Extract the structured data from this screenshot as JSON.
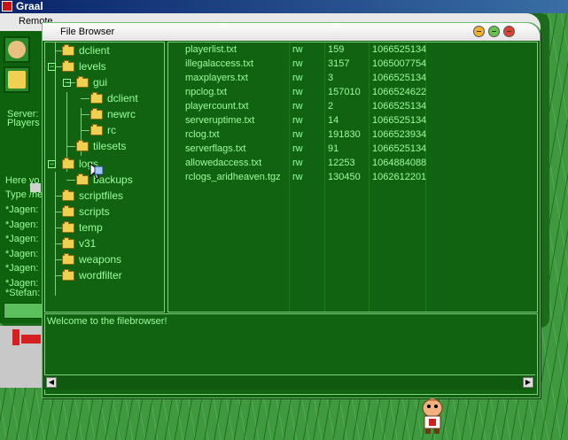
{
  "os": {
    "title": "Graal"
  },
  "remote": {
    "tab_label": "Remote",
    "side_labels": [
      "Server:",
      "Players"
    ],
    "chat_lines": [
      "Here yo",
      "Type /he",
      "*Jagen:",
      "*Jagen:",
      "*Jagen:",
      "*Jagen:",
      "*Jagen:",
      "*Jagen:",
      "*Stefan:"
    ]
  },
  "file_browser": {
    "title": "File Browser",
    "tree": [
      {
        "label": "dclient",
        "depth": 0
      },
      {
        "label": "levels",
        "depth": 0
      },
      {
        "label": "gui",
        "depth": 1
      },
      {
        "label": "dclient",
        "depth": 2
      },
      {
        "label": "newrc",
        "depth": 2
      },
      {
        "label": "rc",
        "depth": 2
      },
      {
        "label": "tilesets",
        "depth": 1
      },
      {
        "label": "logs",
        "depth": 0
      },
      {
        "label": "backups",
        "depth": 1
      },
      {
        "label": "scriptfiles",
        "depth": 0
      },
      {
        "label": "scripts",
        "depth": 0
      },
      {
        "label": "temp",
        "depth": 0
      },
      {
        "label": "v31",
        "depth": 0
      },
      {
        "label": "weapons",
        "depth": 0
      },
      {
        "label": "wordfilter",
        "depth": 0
      }
    ],
    "files": [
      {
        "name": "playerlist.txt",
        "perm": "rw",
        "size": "159",
        "time": "1066525134"
      },
      {
        "name": "illegalaccess.txt",
        "perm": "rw",
        "size": "3157",
        "time": "1065007754"
      },
      {
        "name": "maxplayers.txt",
        "perm": "rw",
        "size": "3",
        "time": "1066525134"
      },
      {
        "name": "npclog.txt",
        "perm": "rw",
        "size": "157010",
        "time": "1066524622"
      },
      {
        "name": "playercount.txt",
        "perm": "rw",
        "size": "2",
        "time": "1066525134"
      },
      {
        "name": "serveruptime.txt",
        "perm": "rw",
        "size": "14",
        "time": "1066525134"
      },
      {
        "name": "rclog.txt",
        "perm": "rw",
        "size": "191830",
        "time": "1066523934"
      },
      {
        "name": "serverflags.txt",
        "perm": "rw",
        "size": "91",
        "time": "1066525134"
      },
      {
        "name": "allowedaccess.txt",
        "perm": "rw",
        "size": "12253",
        "time": "1064884088"
      },
      {
        "name": "rclogs_aridheaven.tgz",
        "perm": "rw",
        "size": "130450",
        "time": "1062612201"
      }
    ],
    "log_message": "Welcome to the filebrowser!"
  },
  "colors": {
    "text": "#9cff9c",
    "panel": "#116211",
    "folder": "#f0d050"
  }
}
